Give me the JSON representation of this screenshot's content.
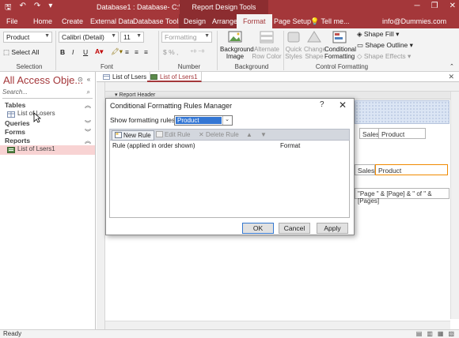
{
  "titlebar": {
    "doc_title": "Database1 : Database- C:\\Users...",
    "context_title": "Report Design Tools"
  },
  "tabs": [
    "File",
    "Home",
    "Create",
    "External Data",
    "Database Tools",
    "Design",
    "Arrange",
    "Format",
    "Page Setup"
  ],
  "tell_me": "Tell me...",
  "user": "info@Dummies.com",
  "ribbon": {
    "object_combo": "Product",
    "font_combo": "Calibri (Detail)",
    "size_combo": "11",
    "format_combo": "Formatting",
    "select_all": "Select All",
    "bold": "B",
    "italic": "I",
    "underline": "U",
    "background_image": "Background Image",
    "alternate_row_color": "Alternate Row Color",
    "quick_styles": "Quick Styles",
    "change_shape": "Change Shape",
    "conditional_formatting": "Conditional Formatting",
    "shape_fill": "Shape Fill",
    "shape_outline": "Shape Outline",
    "shape_effects": "Shape Effects",
    "groups": [
      "Selection",
      "Font",
      "Number",
      "Background",
      "Control Formatting"
    ]
  },
  "nav": {
    "title": "All Access Obje...",
    "search_placeholder": "Search...",
    "sections": {
      "tables": "Tables",
      "queries": "Queries",
      "forms": "Forms",
      "reports": "Reports"
    },
    "table_item": "List of Losers",
    "report_item": "List of Lsers1"
  },
  "doc_tabs": [
    "List of Lsers",
    "List of Lsers1"
  ],
  "canvas": {
    "report_header": "Report Header",
    "field_sales_1": "Sales",
    "field_product_1": "Product",
    "field_sales_2": "Sales",
    "field_product_2": "Product",
    "page_expr": "\"Page \" & [Page] & \" of \" & [Pages]"
  },
  "status": "Ready",
  "dialog": {
    "title": "Conditional Formatting Rules Manager",
    "help": "?",
    "show_label": "Show formatting rules for:",
    "show_value": "Product",
    "new_rule": "New Rule",
    "edit_rule": "Edit Rule",
    "delete_rule": "Delete Rule",
    "col_rule": "Rule (applied in order shown)",
    "col_format": "Format",
    "ok": "OK",
    "cancel": "Cancel",
    "apply": "Apply"
  },
  "colors": {
    "accent": "#a4373a",
    "selection": "#3477d4",
    "nav_selected": "#f8d3d3"
  }
}
